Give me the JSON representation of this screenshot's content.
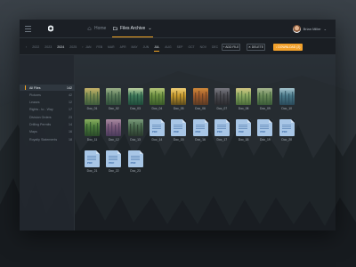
{
  "topbar": {
    "crumbs": [
      {
        "label": "Home",
        "icon": "home-icon"
      },
      {
        "label": "Files Archive",
        "icon": "folder-icon",
        "caret": "⌄"
      }
    ],
    "user": {
      "name": "Brian Miller",
      "caret": "⌄"
    }
  },
  "toolbar": {
    "years": [
      "‹",
      "2022",
      "2023",
      "2024",
      "2025",
      "›"
    ],
    "current_year": "2024",
    "months": [
      "JAN",
      "FEB",
      "MAR",
      "APR",
      "MAY",
      "JUN",
      "JUL",
      "AUG",
      "SEP",
      "OCT",
      "NOV",
      "DEC"
    ],
    "current_month": "JUL",
    "add_label": "+ ADD FILE",
    "delete_label": "✕ DELETE",
    "download_label": "↓ DOWNLOAD (2)"
  },
  "sidebar": {
    "items": [
      {
        "label": "All Files",
        "count": "142",
        "active": true
      },
      {
        "label": "Pictures",
        "count": "42"
      },
      {
        "label": "Leases",
        "count": "12"
      },
      {
        "label": "Rights - to - Way",
        "count": "17"
      },
      {
        "label": "Division Orders",
        "count": "23"
      },
      {
        "label": "Drilling Permits",
        "count": "14"
      },
      {
        "label": "Maps",
        "count": "16"
      },
      {
        "label": "Royalty Statements",
        "count": "18"
      }
    ]
  },
  "files": [
    {
      "name": "Doc_01",
      "type": "image",
      "palette": [
        "#3d5a3c",
        "#7a8a4e",
        "#c9b46a"
      ]
    },
    {
      "name": "Doc_02",
      "type": "image",
      "palette": [
        "#2f4d3a",
        "#5a7a58",
        "#9eb38a"
      ]
    },
    {
      "name": "Doc_03",
      "type": "image",
      "palette": [
        "#1f4a3a",
        "#3f7a5a",
        "#c2d6a4"
      ]
    },
    {
      "name": "Doc_04",
      "type": "image",
      "palette": [
        "#3a5a2a",
        "#6c9040",
        "#b8c87a"
      ]
    },
    {
      "name": "Doc_05",
      "type": "image",
      "palette": [
        "#5a4a1e",
        "#c89a2c",
        "#f0d078"
      ]
    },
    {
      "name": "Doc_06",
      "type": "image",
      "palette": [
        "#5a3a24",
        "#a05a2a",
        "#d08a3a"
      ]
    },
    {
      "name": "Doc_07",
      "type": "image",
      "palette": [
        "#2a2a2e",
        "#4a4a50",
        "#7a7a82"
      ]
    },
    {
      "name": "Doc_08",
      "type": "image",
      "palette": [
        "#4a6a3a",
        "#8aa860",
        "#d4c884"
      ]
    },
    {
      "name": "Doc_09",
      "type": "image",
      "palette": [
        "#3a5a38",
        "#6a8a58",
        "#a8b890"
      ]
    },
    {
      "name": "Doc_10",
      "type": "image",
      "palette": [
        "#2a4a5a",
        "#4a7a8a",
        "#a8c8d0"
      ]
    },
    {
      "name": "Doc_11",
      "type": "image",
      "palette": [
        "#2a4a2a",
        "#4a7a3a",
        "#8ab060"
      ]
    },
    {
      "name": "Doc_12",
      "type": "image",
      "palette": [
        "#4a3a5a",
        "#7a5a7a",
        "#a88aa0"
      ]
    },
    {
      "name": "Doc_13",
      "type": "image",
      "palette": [
        "#2a3a2e",
        "#4a6a4e",
        "#7a9a7a"
      ]
    },
    {
      "name": "Doc_14",
      "type": "pdf"
    },
    {
      "name": "Doc_15",
      "type": "pdf"
    },
    {
      "name": "Doc_16",
      "type": "pdf"
    },
    {
      "name": "Doc_17",
      "type": "pdf"
    },
    {
      "name": "Doc_18",
      "type": "pdf"
    },
    {
      "name": "Doc_19",
      "type": "pdf"
    },
    {
      "name": "Doc_20",
      "type": "pdf"
    },
    {
      "name": "Doc_21",
      "type": "pdf"
    },
    {
      "name": "Doc_22",
      "type": "pdf"
    },
    {
      "name": "Doc_23",
      "type": "pdf"
    }
  ],
  "pdf_label": "PDF",
  "colors": {
    "accent": "#f5a623",
    "pdf": "#a8c6e6",
    "panel": "#22282f"
  }
}
